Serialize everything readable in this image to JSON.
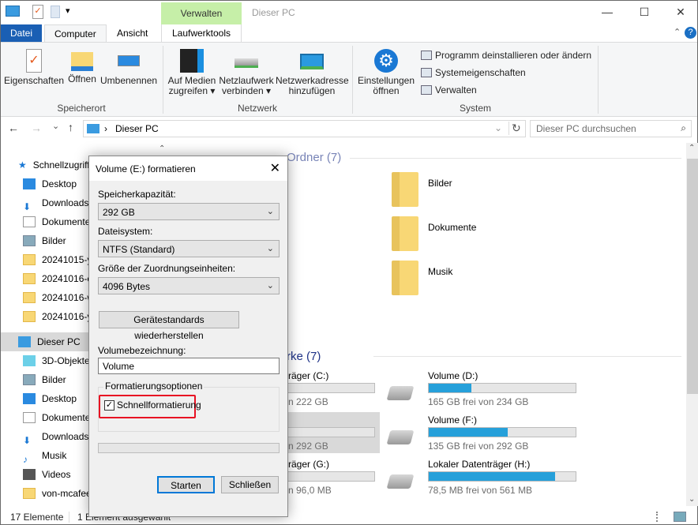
{
  "window": {
    "title": "Dieser PC",
    "contextual_tab": "Verwalten",
    "minimize": "—",
    "maximize": "☐",
    "close": "✕",
    "help": "?",
    "collapse": "⌃"
  },
  "tabs": [
    {
      "label": "Datei"
    },
    {
      "label": "Computer"
    },
    {
      "label": "Ansicht"
    },
    {
      "label": "Laufwerktools"
    }
  ],
  "ribbon": {
    "speicherort": {
      "label": "Speicherort",
      "buttons": [
        "Eigenschaften",
        "Öffnen",
        "Umbenennen"
      ]
    },
    "netzwerk": {
      "label": "Netzwerk",
      "buttons": [
        {
          "l1": "Auf Medien",
          "l2": "zugreifen ▾"
        },
        {
          "l1": "Netzlaufwerk",
          "l2": "verbinden ▾"
        },
        {
          "l1": "Netzwerkadresse",
          "l2": "hinzufügen"
        }
      ]
    },
    "system": {
      "label": "System",
      "settings1": "Einstellungen",
      "settings2": "öffnen",
      "items": [
        "Programm deinstallieren oder ändern",
        "Systemeigenschaften",
        "Verwalten"
      ]
    }
  },
  "address": {
    "path": "Dieser PC",
    "search_placeholder": "Dieser PC durchsuchen",
    "back": "←",
    "forward": "→",
    "recent": "⌄",
    "up": "↑",
    "refresh": "↻",
    "sep": "›"
  },
  "nav": {
    "quick": "Schnellzugriff",
    "quick_items": [
      "Desktop",
      "Downloads",
      "Dokumente",
      "Bilder",
      "20241015-y",
      "20241016-e",
      "20241016-w",
      "20241016-y"
    ],
    "pc": "Dieser PC",
    "pc_items": [
      "3D-Objekte",
      "Bilder",
      "Desktop",
      "Dokumente",
      "Downloads",
      "Musik",
      "Videos",
      "von-mcafee"
    ]
  },
  "content": {
    "folders_heading": "Ordner (7)",
    "folders": [
      "Bilder",
      "Dokumente",
      "Musik"
    ],
    "drives_heading": "rke (7)",
    "drives_left": [
      {
        "name": "räger (C:)",
        "free": "n 222 GB",
        "used_pct": 8
      },
      {
        "name": "",
        "free": "n 292 GB",
        "used_pct": 0
      },
      {
        "name": "räger (G:)",
        "free": "n 96,0 MB",
        "used_pct": 0
      }
    ],
    "drives_right": [
      {
        "name": "Volume (D:)",
        "free": "165 GB frei von 234 GB",
        "used_pct": 29
      },
      {
        "name": "Volume (F:)",
        "free": "135 GB frei von 292 GB",
        "used_pct": 54
      },
      {
        "name": "Lokaler Datenträger (H:)",
        "free": "78,5 MB frei von 561 MB",
        "used_pct": 86
      }
    ]
  },
  "status": {
    "count": "17 Elemente",
    "selected": "1 Element ausgewählt"
  },
  "dialog": {
    "title": "Volume (E:) formatieren",
    "capacity_label": "Speicherkapazität:",
    "capacity": "292 GB",
    "fs_label": "Dateisystem:",
    "fs": "NTFS (Standard)",
    "alloc_label": "Größe der Zuordnungseinheiten:",
    "alloc": "4096 Bytes",
    "restore": "Gerätestandards wiederherstellen",
    "volume_label": "Volumebezeichnung:",
    "volume": "Volume",
    "options_label": "Formatierungsoptionen",
    "quick": "Schnellformatierung",
    "quick_checked": true,
    "progress_pct": 0,
    "start": "Starten",
    "close": "Schließen",
    "highlight_color": "#e81123"
  }
}
